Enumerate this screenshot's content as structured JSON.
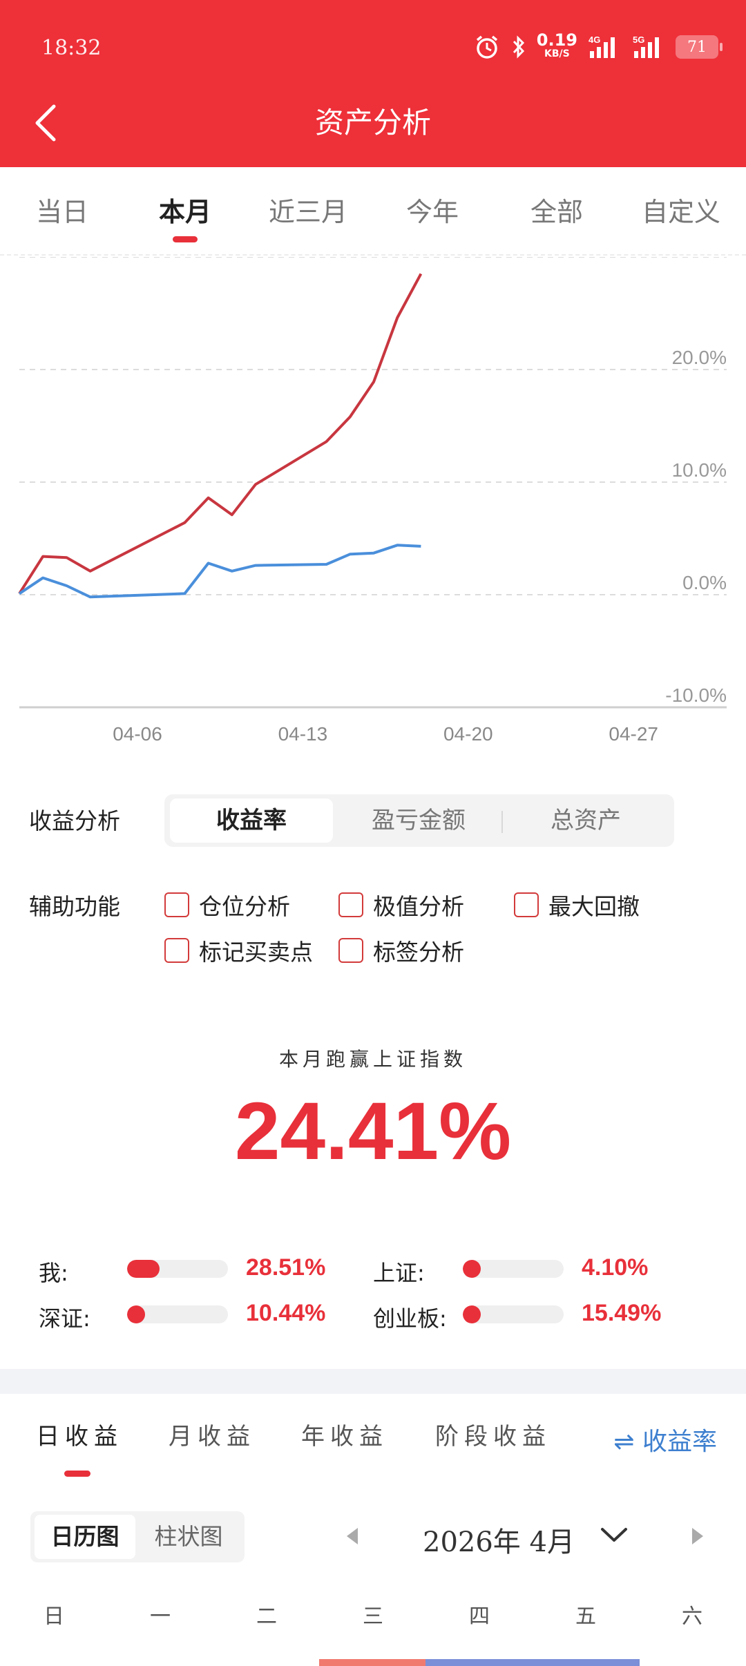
{
  "status": {
    "time": "18:32",
    "net_speed": "0.19",
    "net_unit": "KB/S",
    "sig1": "4G",
    "sig2": "5G",
    "battery": "71"
  },
  "header": {
    "title": "资产分析"
  },
  "tabs": [
    {
      "label": "当日"
    },
    {
      "label": "本月"
    },
    {
      "label": "近三月"
    },
    {
      "label": "今年"
    },
    {
      "label": "全部"
    },
    {
      "label": "自定义"
    }
  ],
  "chart_data": {
    "type": "line",
    "y_ticks": [
      "20.0%",
      "10.0%",
      "0.0%",
      "-10.0%"
    ],
    "x_ticks": [
      "04-06",
      "04-13",
      "04-20",
      "04-27"
    ],
    "ylim": [
      -10,
      30
    ],
    "grid": true,
    "colors": {
      "me": "#c8363f",
      "index": "#4a8fdb"
    },
    "series": [
      {
        "x": [
          0,
          1,
          2,
          3,
          7,
          8,
          9,
          10,
          13,
          14,
          15,
          16,
          17
        ],
        "values": [
          0.1,
          3.4,
          3.3,
          2.1,
          6.4,
          8.6,
          7.1,
          9.8,
          13.6,
          15.8,
          18.9,
          24.6,
          28.5
        ]
      },
      {
        "x": [
          0,
          1,
          2,
          3,
          7,
          8,
          9,
          10,
          13,
          14,
          15,
          16,
          17
        ],
        "values": [
          0.1,
          1.5,
          0.8,
          -0.2,
          0.1,
          2.8,
          2.1,
          2.6,
          2.7,
          3.6,
          3.7,
          4.4,
          4.3
        ]
      }
    ]
  },
  "analysis": {
    "label": "收益分析",
    "segments": [
      "收益率",
      "盈亏金额",
      "总资产"
    ]
  },
  "aux": {
    "label": "辅助功能",
    "options": [
      "仓位分析",
      "极值分析",
      "最大回撤",
      "标记买卖点",
      "标签分析"
    ]
  },
  "compare": {
    "title": "本月跑赢上证指数",
    "value": "24.41%",
    "rows": [
      {
        "label": "我:",
        "value": "28.51%",
        "pct": 0.32
      },
      {
        "label": "上证:",
        "value": "4.10%",
        "pct": 0.06
      },
      {
        "label": "深证:",
        "value": "10.44%",
        "pct": 0.12
      },
      {
        "label": "创业板:",
        "value": "15.49%",
        "pct": 0.17
      }
    ]
  },
  "period_tabs": [
    "日收益",
    "月收益",
    "年收益",
    "阶段收益"
  ],
  "yield_toggle": "⇌ 收益率",
  "calendar": {
    "views": [
      "日历图",
      "柱状图"
    ],
    "month": "2026年 4月",
    "weekdays": [
      "日",
      "一",
      "二",
      "三",
      "四",
      "五",
      "六"
    ]
  }
}
